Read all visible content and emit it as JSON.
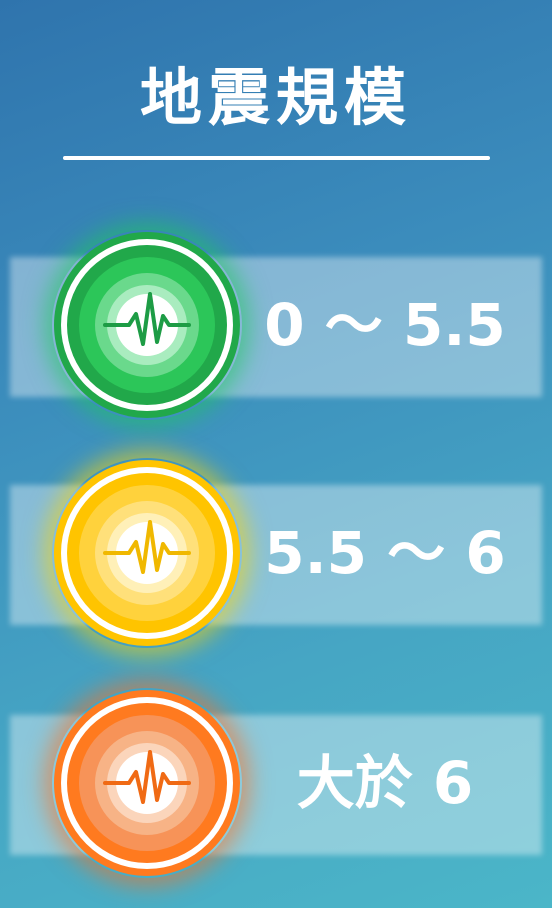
{
  "title": "地震規模",
  "levels": [
    {
      "range": "0 ～ 5.5",
      "icon": "seismic-wave-icon",
      "colors": {
        "outer": "#21a84a",
        "mid": "#2cc659",
        "inner": "#6ad98c",
        "core": "#a9ecbf",
        "wave": "#1d9c45"
      }
    },
    {
      "range": "5.5 ～ 6",
      "icon": "seismic-wave-icon",
      "colors": {
        "outer": "#ffc400",
        "mid": "#ffd23c",
        "inner": "#ffe07a",
        "core": "#fff0b8",
        "wave": "#f0b800"
      }
    },
    {
      "range": "大於 6",
      "icon": "seismic-wave-icon",
      "colors": {
        "outer": "#ff7a1f",
        "mid": "#f79358",
        "inner": "#f7b386",
        "core": "#fbd5bb",
        "wave": "#f06a14"
      }
    }
  ]
}
